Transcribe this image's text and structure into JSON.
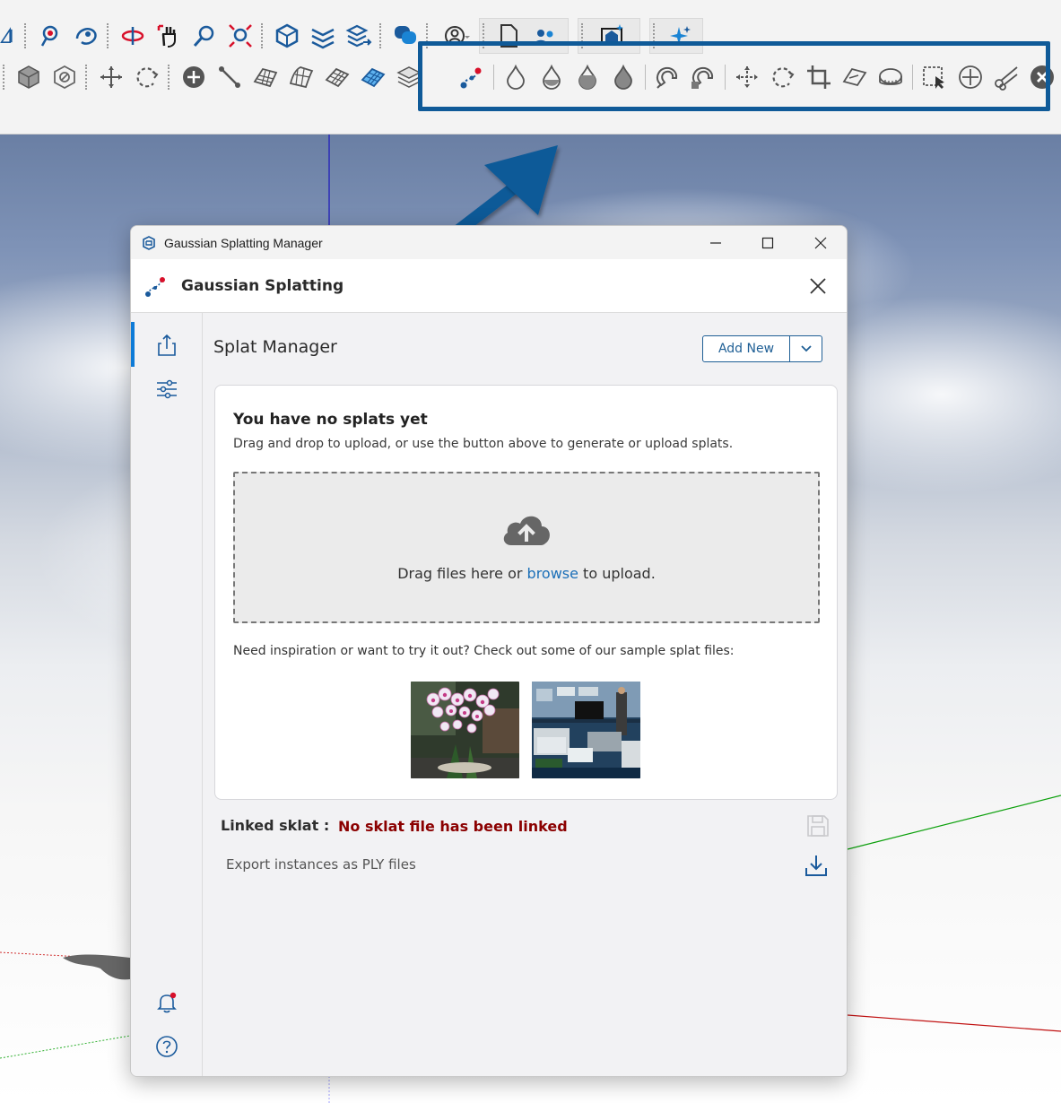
{
  "dialog": {
    "window_title": "Gaussian Splatting Manager",
    "header_title": "Gaussian Splatting",
    "section_title": "Splat Manager",
    "add_new_label": "Add New",
    "empty_title": "You have no splats yet",
    "empty_subtitle": "Drag and drop to upload, or use the button above to generate or upload splats.",
    "drop_text_before": "Drag files here or ",
    "drop_link": "browse",
    "drop_text_after": " to upload.",
    "inspiration_text": "Need inspiration or want to try it out? Check out some of our sample splat files:",
    "samples": [
      "orchid-sample-image",
      "living-room-sample-image"
    ],
    "linked_label": "Linked sklat :",
    "linked_value": "No sklat file has been linked",
    "export_label": "Export instances as PLY files"
  },
  "rail": [
    "upload-icon",
    "settings-sliders-icon",
    "notification-bell-icon",
    "help-icon"
  ],
  "colors": {
    "accent_blue": "#0f5a98",
    "link_blue": "#1b6fb8",
    "error_red": "#8b0000",
    "callout_border": "#0f5a98"
  }
}
